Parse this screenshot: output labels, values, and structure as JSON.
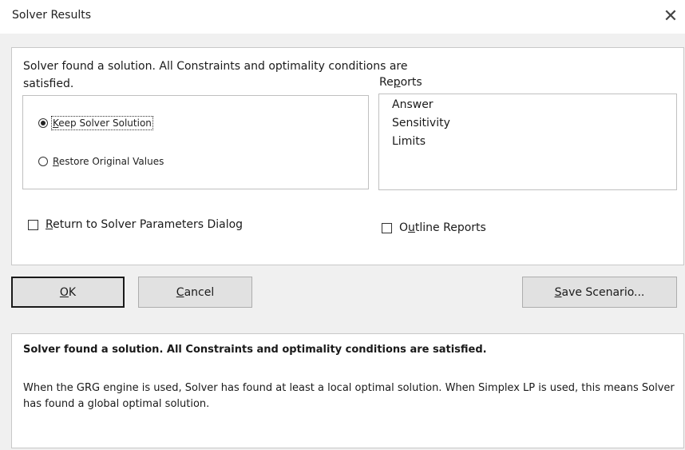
{
  "window": {
    "title": "Solver Results",
    "close_glyph": "✕"
  },
  "main": {
    "status_message": "Solver found a solution.  All Constraints and optimality conditions are satisfied.",
    "radio_options": [
      {
        "prefix": "",
        "accel": "K",
        "rest": "eep Solver Solution",
        "checked": true
      },
      {
        "prefix": "",
        "accel": "R",
        "rest": "estore Original Values",
        "checked": false
      }
    ],
    "reports": {
      "label_prefix": "Re",
      "label_accel": "p",
      "label_rest": "orts",
      "items": [
        "Answer",
        "Sensitivity",
        "Limits"
      ]
    },
    "return_checkbox": {
      "prefix": "",
      "accel": "R",
      "rest": "eturn to Solver Parameters Dialog",
      "checked": false
    },
    "outline_checkbox": {
      "prefix": "O",
      "accel": "u",
      "rest": "tline Reports",
      "checked": false
    }
  },
  "buttons": {
    "ok": {
      "prefix": "",
      "accel": "O",
      "rest": "K"
    },
    "cancel": {
      "prefix": "",
      "accel": "C",
      "rest": "ancel"
    },
    "save": {
      "prefix": "",
      "accel": "S",
      "rest": "ave Scenario..."
    }
  },
  "bottom": {
    "headline": "Solver found a solution.  All Constraints and optimality conditions are satisfied.",
    "body": "When the GRG engine is used, Solver has found at least a local optimal solution. When Simplex LP is used, this means Solver has found a global optimal solution."
  }
}
